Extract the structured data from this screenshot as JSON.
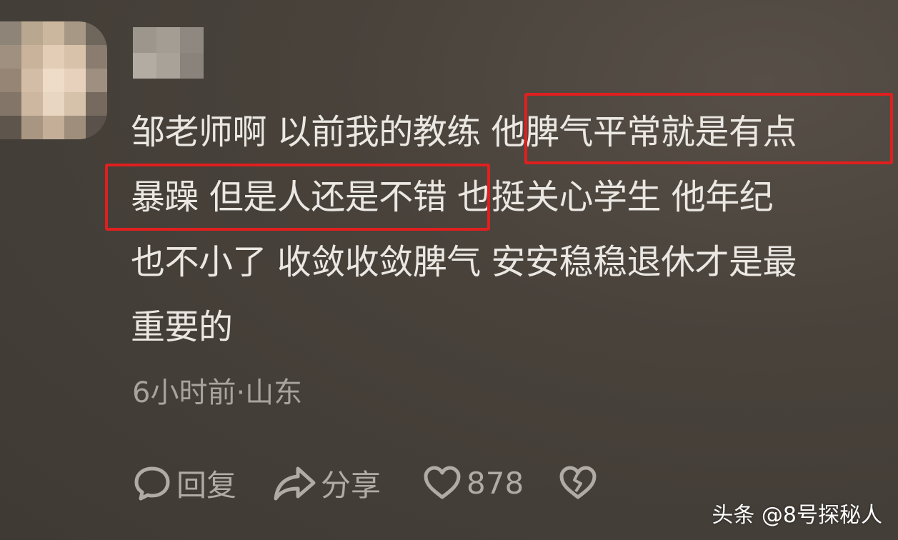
{
  "colors": {
    "background": "#48423b",
    "text": "#ebe8e3",
    "meta_text": "#a8a39c",
    "action_text": "#b0aba4",
    "highlight_box": "#e01f1f"
  },
  "comment": {
    "lines": [
      "邹老师啊 以前我的教练 他脾气平常就是有点",
      "暴躁 但是人还是不错 也挺关心学生 他年纪",
      "也不小了 收敛收敛脾气 安安稳稳退休才是最",
      "重要的"
    ],
    "meta": "6小时前·山东",
    "actions": {
      "reply_label": "回复",
      "share_label": "分享",
      "like_count": "878"
    }
  },
  "icons": {
    "reply": "speech-bubble-icon",
    "share": "share-arrow-icon",
    "like": "heart-icon",
    "dislike": "broken-heart-icon"
  },
  "watermark": "头条 @8号探秘人"
}
